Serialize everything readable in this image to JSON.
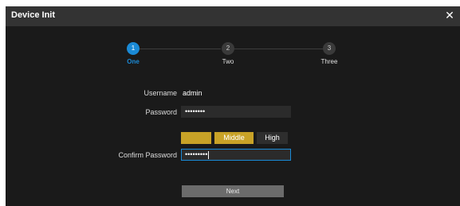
{
  "dialog": {
    "title": "Device Init",
    "close_glyph": "✕"
  },
  "steps": [
    {
      "number": "1",
      "label": "One",
      "active": true
    },
    {
      "number": "2",
      "label": "Two",
      "active": false
    },
    {
      "number": "3",
      "label": "Three",
      "active": false
    }
  ],
  "form": {
    "username_label": "Username",
    "username_value": "admin",
    "password_label": "Password",
    "password_value": "••••••••",
    "confirm_label": "Confirm Password",
    "confirm_value": "•••••••••"
  },
  "strength": {
    "levels": [
      "",
      "Middle",
      "High"
    ],
    "current": "Middle",
    "active_color": "#c8a227",
    "inactive_color": "#2e2e2e"
  },
  "actions": {
    "next_label": "Next"
  },
  "colors": {
    "accent": "#1a8ad6",
    "dialog_bg": "#1a1a1a",
    "titlebar_bg": "#333333"
  }
}
